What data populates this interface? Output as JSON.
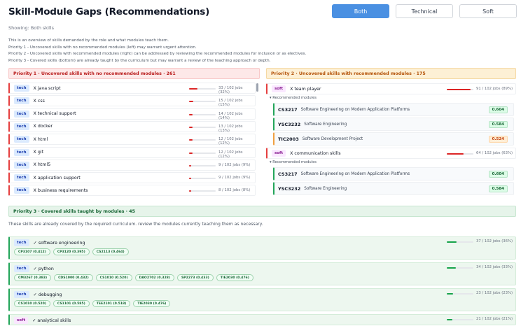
{
  "header": {
    "title": "Skill-Module Gaps (Recommendations)"
  },
  "filter": {
    "options": [
      "Both",
      "Technical",
      "Soft"
    ],
    "selected": "Both",
    "showing": "Showing: Both skills"
  },
  "description": [
    "This is an overview of skills demanded by the role and what modules teach them.",
    "Priority 1 - Uncovered skills with no recommended modules (left) may warrant urgent attention.",
    "Priority 2 - Uncovered skills with recommended modules (right) can be addressed by reviewing the recommended modules for inclusion or as electives.",
    "Priority 3 - Covered skills (bottom) are already taught by the curriculum but may warrant a review of the teaching approach or depth."
  ],
  "priority1": {
    "header": "Priority 1 · Uncovered skills with no recommended modules · 261",
    "items": [
      {
        "type": "tech",
        "skill": "X java script",
        "stat": "33 / 102 jobs (32%)",
        "pct": 32
      },
      {
        "type": "tech",
        "skill": "X css",
        "stat": "15 / 102 jobs (15%)",
        "pct": 15
      },
      {
        "type": "tech",
        "skill": "X technical support",
        "stat": "14 / 102 jobs (14%)",
        "pct": 14
      },
      {
        "type": "tech",
        "skill": "X docker",
        "stat": "13 / 102 jobs (13%)",
        "pct": 13
      },
      {
        "type": "tech",
        "skill": "X html",
        "stat": "12 / 102 jobs (12%)",
        "pct": 12
      },
      {
        "type": "tech",
        "skill": "X git",
        "stat": "12 / 102 jobs (12%)",
        "pct": 12
      },
      {
        "type": "tech",
        "skill": "X html5",
        "stat": "9 / 102 jobs (9%)",
        "pct": 9
      },
      {
        "type": "tech",
        "skill": "X application support",
        "stat": "9 / 102 jobs (9%)",
        "pct": 9
      },
      {
        "type": "tech",
        "skill": "X business requirements",
        "stat": "8 / 102 jobs (8%)",
        "pct": 8
      }
    ]
  },
  "priority2": {
    "header": "Priority 2 · Uncovered skills with recommended modules · 175",
    "rec_label": "▾ Recommended modules",
    "items": [
      {
        "type": "soft",
        "skill": "X team player",
        "stat": "91 / 102 jobs (89%)",
        "pct": 89,
        "modules": [
          {
            "code": "CS3217",
            "name": "Software Engineering on Modern Application Platforms",
            "score": "0.604",
            "tone": "green"
          },
          {
            "code": "YSC3232",
            "name": "Software Engineering",
            "score": "0.584",
            "tone": "green"
          },
          {
            "code": "TIC2003",
            "name": "Software Development Project",
            "score": "0.524",
            "tone": "orange"
          }
        ]
      },
      {
        "type": "soft",
        "skill": "X communication skills",
        "stat": "64 / 102 jobs (63%)",
        "pct": 63,
        "modules": [
          {
            "code": "CS3217",
            "name": "Software Engineering on Modern Application Platforms",
            "score": "0.604",
            "tone": "green"
          },
          {
            "code": "YSC3232",
            "name": "Software Engineering",
            "score": "0.584",
            "tone": "green"
          }
        ]
      }
    ]
  },
  "priority3": {
    "header": "Priority 3 · Covered skills taught by modules · 45",
    "description": "These skills are already covered by the required curriculum. review the modules currently teaching them as necessary.",
    "items": [
      {
        "type": "tech",
        "skill": "✓ software engineering",
        "stat": "37 / 102 jobs (36%)",
        "pct": 36,
        "chips": [
          "CP3107 (0.412)",
          "CP3120 (0.395)",
          "CS2113 (0.464)"
        ]
      },
      {
        "type": "tech",
        "skill": "✓ python",
        "stat": "34 / 102 jobs (33%)",
        "pct": 33,
        "chips": [
          "CM3267 (0.383)",
          "CDS1000 (0.432)",
          "CS1010 (0.520)",
          "DAO2702 (0.328)",
          "SP2273 (0.433)",
          "TIE2030 (0.476)"
        ]
      },
      {
        "type": "tech",
        "skill": "✓ debugging",
        "stat": "23 / 102 jobs (23%)",
        "pct": 23,
        "chips": [
          "CS1010 (0.520)",
          "CS1101 (0.585)",
          "TEE2101 (0.518)",
          "TIE2030 (0.476)"
        ]
      },
      {
        "type": "soft",
        "skill": "✓ analytical skills",
        "stat": "21 / 102 jobs (21%)",
        "pct": 21,
        "chips": []
      }
    ]
  }
}
